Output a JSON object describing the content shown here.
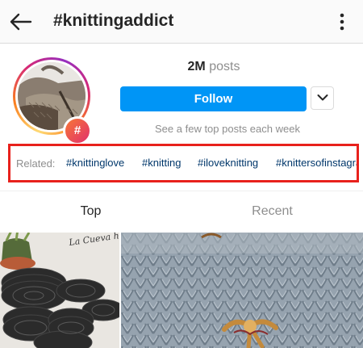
{
  "header": {
    "title": "#knittingaddict",
    "back_icon": "back-arrow-icon",
    "more_icon": "more-vertical-icon"
  },
  "profile": {
    "posts_count": "2M",
    "posts_label": "posts",
    "follow_label": "Follow",
    "dropdown_icon": "chevron-down-icon",
    "hint": "See a few top posts each week",
    "badge": "#"
  },
  "related": {
    "label": "Related:",
    "tags": [
      "#knittinglove",
      "#knitting",
      "#iloveknitting",
      "#knittersofinstagram"
    ]
  },
  "tabs": {
    "top": "Top",
    "recent": "Recent"
  },
  "tile_caption": "La Cueva handmade",
  "colors": {
    "follow_button": "#0095f6",
    "highlight_border": "#e8211c",
    "hashtag_link": "#00376b",
    "muted_text": "#8e8e8e"
  }
}
